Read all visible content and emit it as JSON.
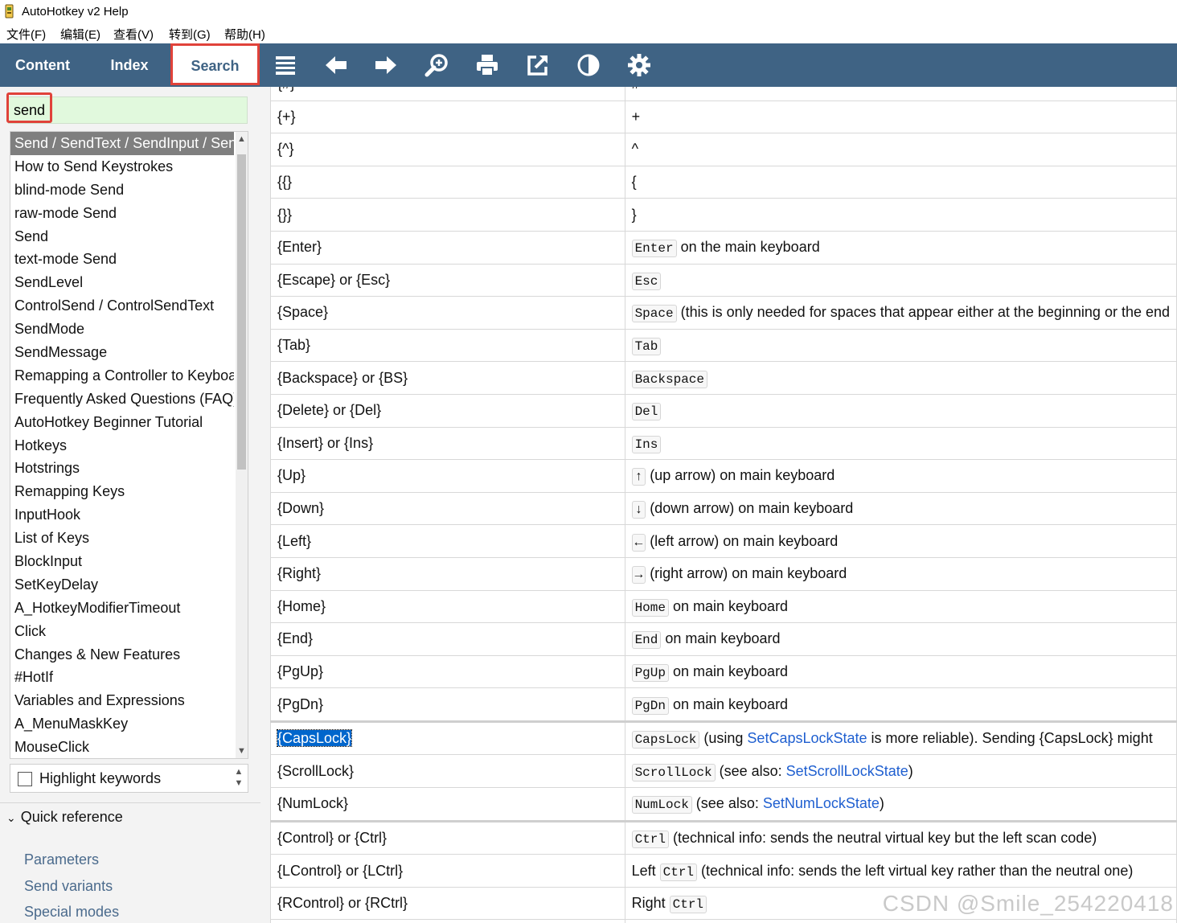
{
  "window": {
    "title": "AutoHotkey v2 Help"
  },
  "menu": [
    {
      "label": "文件(F)"
    },
    {
      "label": "编辑(E)"
    },
    {
      "label": "查看(V)"
    },
    {
      "label": "转到(G)"
    },
    {
      "label": "帮助(H)"
    }
  ],
  "toolbar": {
    "tabs": {
      "content": "Content",
      "index": "Index",
      "search": "Search"
    },
    "icons": [
      "menu-icon",
      "back-arrow-icon",
      "forward-arrow-icon",
      "zoom-icon",
      "print-icon",
      "external-link-icon",
      "contrast-icon",
      "gear-icon"
    ],
    "background": "#3f6384",
    "accent": "#e0423a"
  },
  "search": {
    "value": "send"
  },
  "results": [
    "Send / SendText / SendInput / SendPlay / SendEvent",
    "How to Send Keystrokes",
    "blind-mode Send",
    "raw-mode Send",
    "Send",
    "text-mode Send",
    "SendLevel",
    "ControlSend / ControlSendText",
    "SendMode",
    "SendMessage",
    "Remapping a Controller to Keyboard or Mouse",
    "Frequently Asked Questions (FAQ)",
    "AutoHotkey Beginner Tutorial",
    "Hotkeys",
    "Hotstrings",
    "Remapping Keys",
    "InputHook",
    "List of Keys",
    "BlockInput",
    "SetKeyDelay",
    "A_HotkeyModifierTimeout",
    "Click",
    "Changes & New Features",
    "#HotIf",
    "Variables and Expressions",
    "A_MenuMaskKey",
    "MouseClick"
  ],
  "highlight_keywords": {
    "label": "Highlight keywords",
    "checked": false
  },
  "quick_reference": {
    "label": "Quick reference",
    "links": [
      "Parameters",
      "Send variants",
      "Special modes"
    ]
  },
  "table": {
    "rows": [
      {
        "key": "{#}",
        "desc": [
          {
            "t": "text",
            "v": "#"
          }
        ]
      },
      {
        "key": "{+}",
        "desc": [
          {
            "t": "text",
            "v": "+"
          }
        ]
      },
      {
        "key": "{^}",
        "desc": [
          {
            "t": "text",
            "v": "^"
          }
        ]
      },
      {
        "key": "{{}",
        "desc": [
          {
            "t": "text",
            "v": "{"
          }
        ]
      },
      {
        "key": "{}}",
        "desc": [
          {
            "t": "text",
            "v": "}"
          }
        ]
      },
      {
        "key": "{Enter}",
        "desc": [
          {
            "t": "code",
            "v": "Enter"
          },
          {
            "t": "text",
            "v": " on the main keyboard"
          }
        ]
      },
      {
        "key": "{Escape} or {Esc}",
        "desc": [
          {
            "t": "code",
            "v": "Esc"
          }
        ]
      },
      {
        "key": "{Space}",
        "desc": [
          {
            "t": "code",
            "v": "Space"
          },
          {
            "t": "text",
            "v": " (this is only needed for spaces that appear either at the beginning or the end"
          }
        ]
      },
      {
        "key": "{Tab}",
        "desc": [
          {
            "t": "code",
            "v": "Tab"
          }
        ]
      },
      {
        "key": "{Backspace} or {BS}",
        "desc": [
          {
            "t": "code",
            "v": "Backspace"
          }
        ]
      },
      {
        "key": "{Delete} or {Del}",
        "desc": [
          {
            "t": "code",
            "v": "Del"
          }
        ]
      },
      {
        "key": "{Insert} or {Ins}",
        "desc": [
          {
            "t": "code",
            "v": "Ins"
          }
        ]
      },
      {
        "key": "{Up}",
        "desc": [
          {
            "t": "code",
            "v": "↑"
          },
          {
            "t": "text",
            "v": " (up arrow) on main keyboard"
          }
        ]
      },
      {
        "key": "{Down}",
        "desc": [
          {
            "t": "code",
            "v": "↓"
          },
          {
            "t": "text",
            "v": " (down arrow) on main keyboard"
          }
        ]
      },
      {
        "key": "{Left}",
        "desc": [
          {
            "t": "code",
            "v": "←"
          },
          {
            "t": "text",
            "v": " (left arrow) on main keyboard"
          }
        ]
      },
      {
        "key": "{Right}",
        "desc": [
          {
            "t": "code",
            "v": "→"
          },
          {
            "t": "text",
            "v": " (right arrow) on main keyboard"
          }
        ]
      },
      {
        "key": "{Home}",
        "desc": [
          {
            "t": "code",
            "v": "Home"
          },
          {
            "t": "text",
            "v": " on main keyboard"
          }
        ]
      },
      {
        "key": "{End}",
        "desc": [
          {
            "t": "code",
            "v": "End"
          },
          {
            "t": "text",
            "v": " on main keyboard"
          }
        ]
      },
      {
        "key": "{PgUp}",
        "desc": [
          {
            "t": "code",
            "v": "PgUp"
          },
          {
            "t": "text",
            "v": " on main keyboard"
          }
        ]
      },
      {
        "key": "{PgDn}",
        "desc": [
          {
            "t": "code",
            "v": "PgDn"
          },
          {
            "t": "text",
            "v": " on main keyboard"
          }
        ]
      },
      {
        "key": "{CapsLock}",
        "selected": true,
        "thick": true,
        "desc": [
          {
            "t": "code",
            "v": "CapsLock"
          },
          {
            "t": "text",
            "v": " (using "
          },
          {
            "t": "link",
            "v": "SetCapsLockState"
          },
          {
            "t": "text",
            "v": " is more reliable). Sending {CapsLock} might"
          }
        ]
      },
      {
        "key": "{ScrollLock}",
        "desc": [
          {
            "t": "code",
            "v": "ScrollLock"
          },
          {
            "t": "text",
            "v": " (see also: "
          },
          {
            "t": "link",
            "v": "SetScrollLockState"
          },
          {
            "t": "text",
            "v": ")"
          }
        ]
      },
      {
        "key": "{NumLock}",
        "desc": [
          {
            "t": "code",
            "v": "NumLock"
          },
          {
            "t": "text",
            "v": " (see also: "
          },
          {
            "t": "link",
            "v": "SetNumLockState"
          },
          {
            "t": "text",
            "v": ")"
          }
        ]
      },
      {
        "key": "{Control} or {Ctrl}",
        "thick": true,
        "desc": [
          {
            "t": "code",
            "v": "Ctrl"
          },
          {
            "t": "text",
            "v": " (technical info: sends the neutral virtual key but the left scan code)"
          }
        ]
      },
      {
        "key": "{LControl} or {LCtrl}",
        "desc": [
          {
            "t": "text",
            "v": "Left "
          },
          {
            "t": "code",
            "v": "Ctrl"
          },
          {
            "t": "text",
            "v": " (technical info: sends the left virtual key rather than the neutral one)"
          }
        ]
      },
      {
        "key": "{RControl} or {RCtrl}",
        "desc": [
          {
            "t": "text",
            "v": "Right "
          },
          {
            "t": "code",
            "v": "Ctrl"
          }
        ]
      },
      {
        "key": "",
        "desc": []
      }
    ]
  },
  "watermark": "CSDN @Smile_254220418"
}
